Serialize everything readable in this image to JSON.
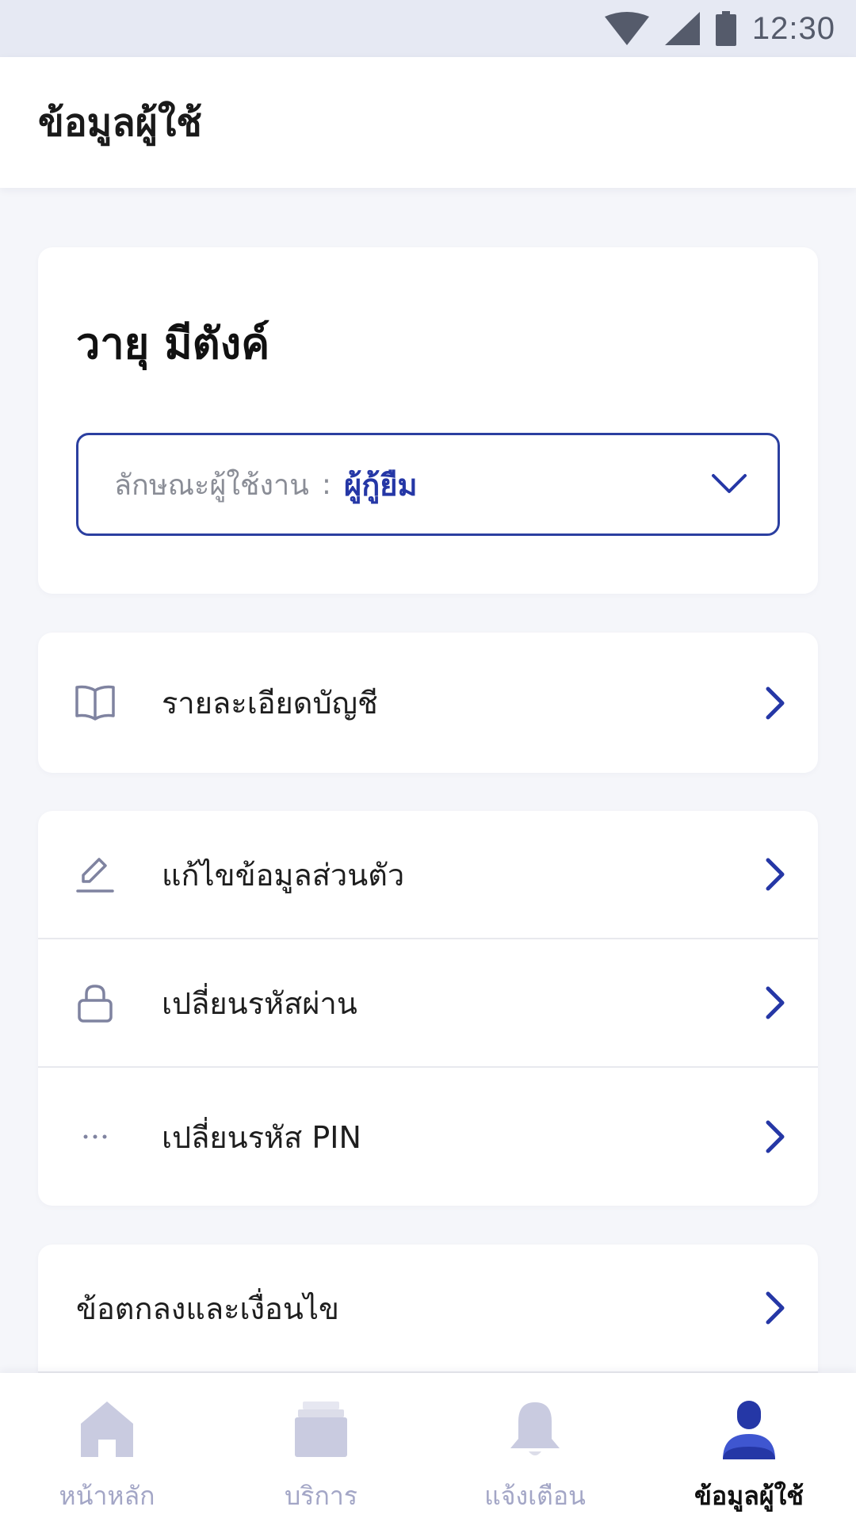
{
  "status_bar": {
    "time": "12:30"
  },
  "header": {
    "title": "ข้อมูลผู้ใช้"
  },
  "profile": {
    "name": "วายุ มีตังค์",
    "role_label": "ลักษณะผู้ใช้งาน",
    "role_separator": ":",
    "role_value": "ผู้กู้ยืม"
  },
  "menu": {
    "account_details": "รายละเอียดบัญชี",
    "edit_profile": "แก้ไขข้อมูลส่วนตัว",
    "change_password": "เปลี่ยนรหัสผ่าน",
    "change_pin": "เปลี่ยนรหัส PIN",
    "terms": "ข้อตกลงและเงื่อนไข"
  },
  "bottom_nav": {
    "items": [
      {
        "label": "หน้าหลัก",
        "icon": "home-icon",
        "active": false
      },
      {
        "label": "บริการ",
        "icon": "services-icon",
        "active": false
      },
      {
        "label": "แจ้งเตือน",
        "icon": "bell-icon",
        "active": false
      },
      {
        "label": "ข้อมูลผู้ใช้",
        "icon": "user-icon",
        "active": true
      }
    ]
  },
  "colors": {
    "accent": "#2537a6",
    "icon_gray": "#7f83a0",
    "nav_inactive": "#c9cbe0",
    "background": "#f5f6fa"
  }
}
